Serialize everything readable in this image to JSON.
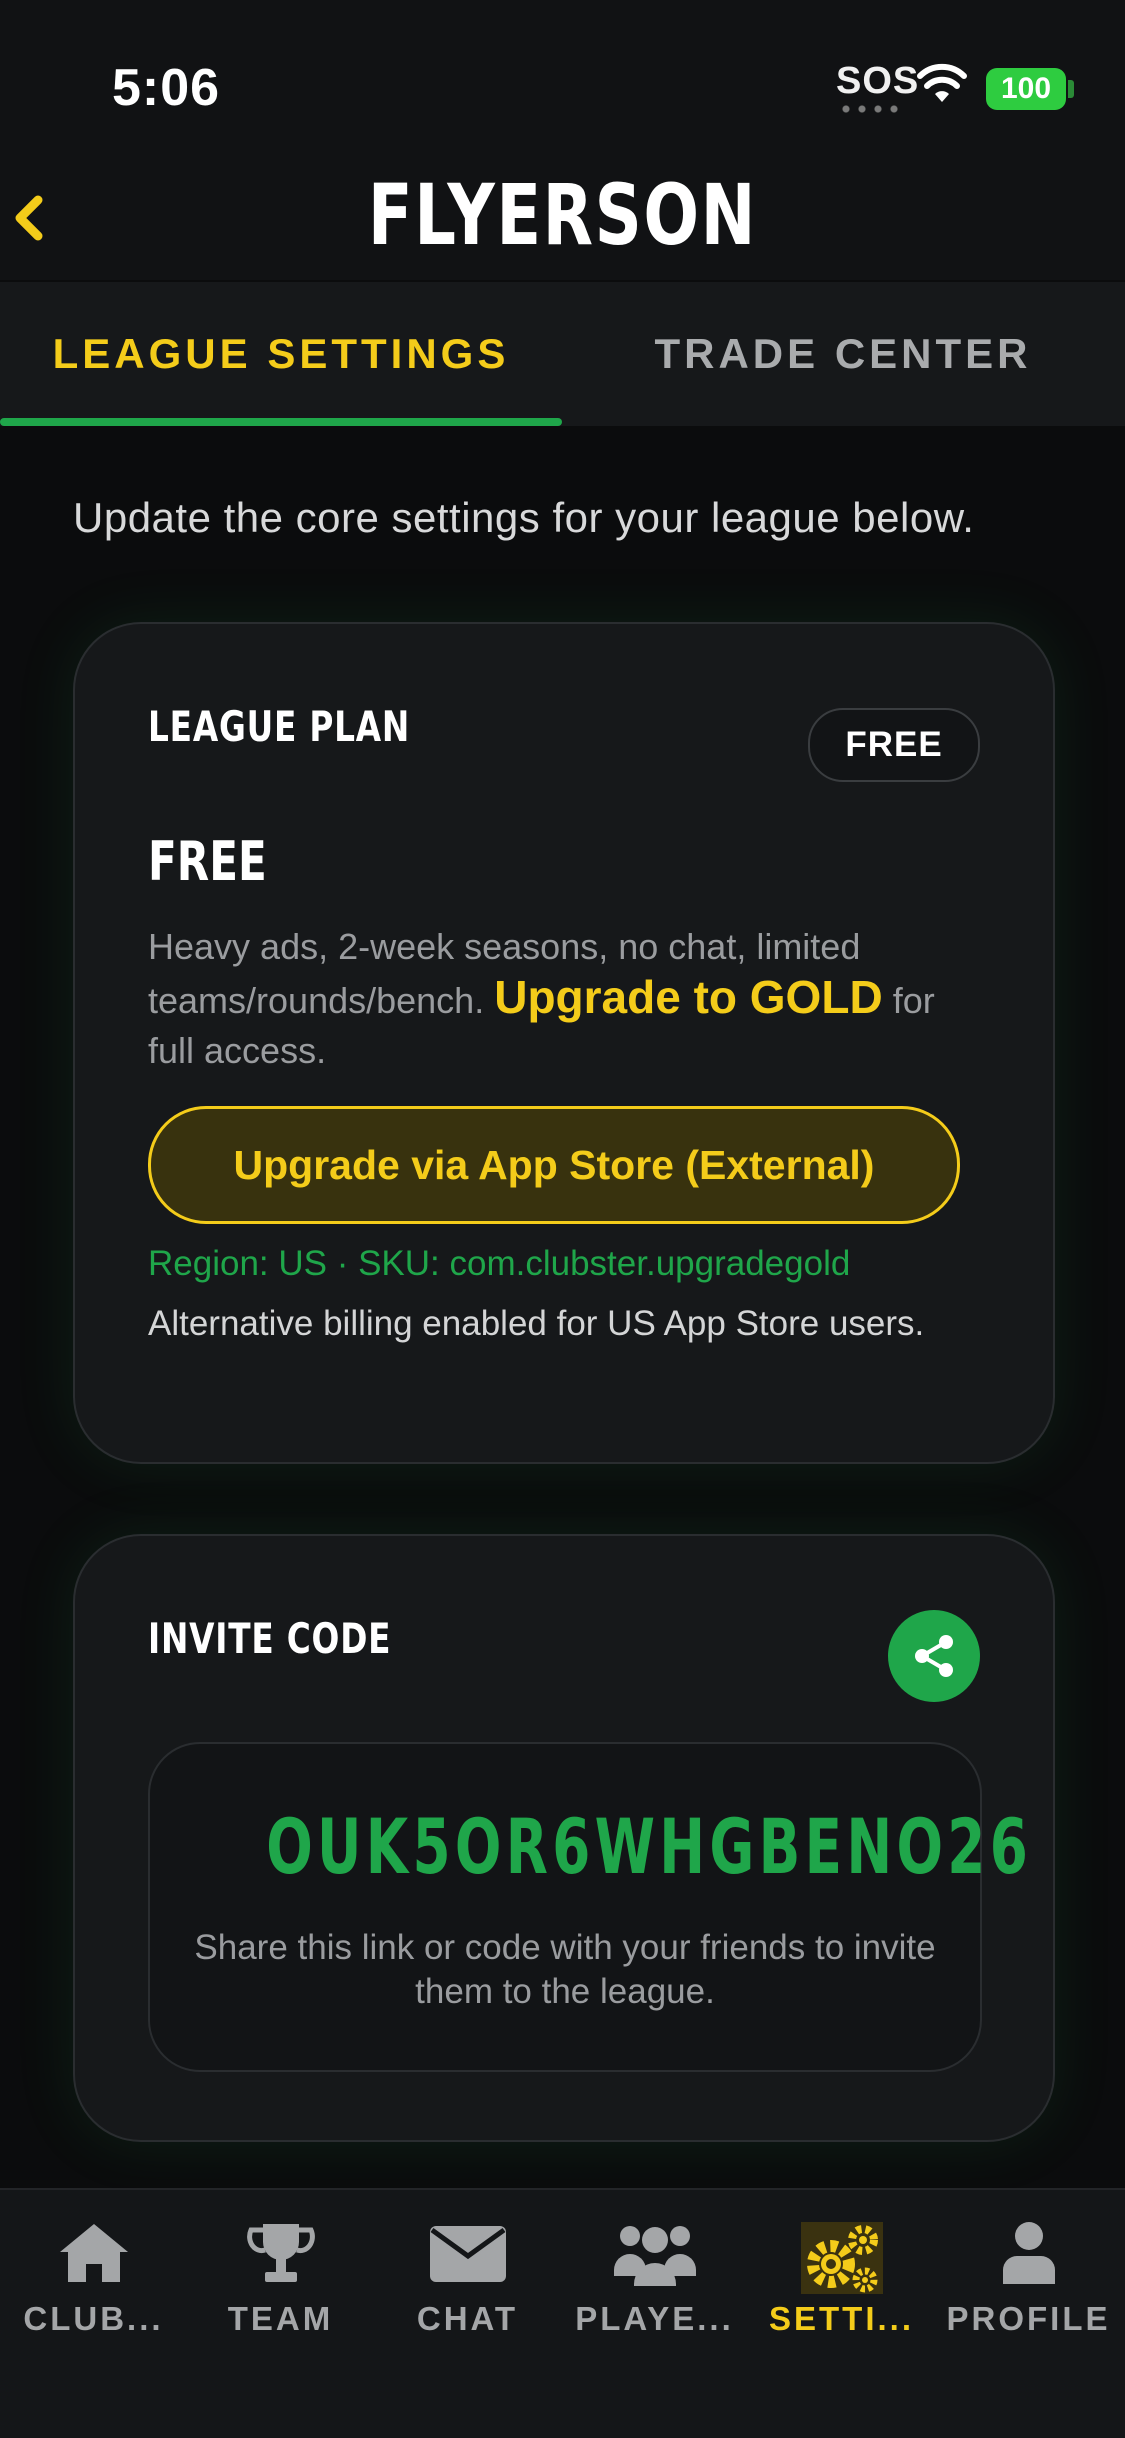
{
  "status": {
    "time": "5:06",
    "sos": "SOS",
    "battery": "100"
  },
  "header": {
    "title": "FLYERSON",
    "back_icon": "chevron-left-icon"
  },
  "tabs": [
    {
      "label": "LEAGUE SETTINGS",
      "active": true
    },
    {
      "label": "TRADE CENTER",
      "active": false
    }
  ],
  "intro": "Update the core settings for your league below.",
  "plan": {
    "heading": "LEAGUE PLAN",
    "badge": "FREE",
    "name": "FREE",
    "desc_pre": "Heavy ads, 2-week seasons, no chat, limited teams/rounds/bench.",
    "desc_gold": "Upgrade to GOLD",
    "desc_post": "for full access.",
    "button": "Upgrade via App Store (External)",
    "region": "Region: US · SKU: com.clubster.upgradegold",
    "billing": "Alternative billing enabled for US App Store users."
  },
  "invite": {
    "heading": "INVITE CODE",
    "code": "OUK5OR6WHGBENO26",
    "hint": "Share this link or code with your friends to invite them to the league.",
    "share_icon": "share-icon"
  },
  "nav": [
    {
      "label": "CLUB...",
      "icon": "home-icon",
      "active": false
    },
    {
      "label": "TEAM",
      "icon": "trophy-icon",
      "active": false
    },
    {
      "label": "CHAT",
      "icon": "mail-icon",
      "active": false
    },
    {
      "label": "PLAYE...",
      "icon": "users-icon",
      "active": false
    },
    {
      "label": "SETTI...",
      "icon": "gears-icon",
      "active": true
    },
    {
      "label": "PROFILE",
      "icon": "user-icon",
      "active": false
    }
  ],
  "colors": {
    "accent_gold": "#f4cc1a",
    "accent_green": "#1fa64a",
    "background": "#0b0c0d"
  }
}
